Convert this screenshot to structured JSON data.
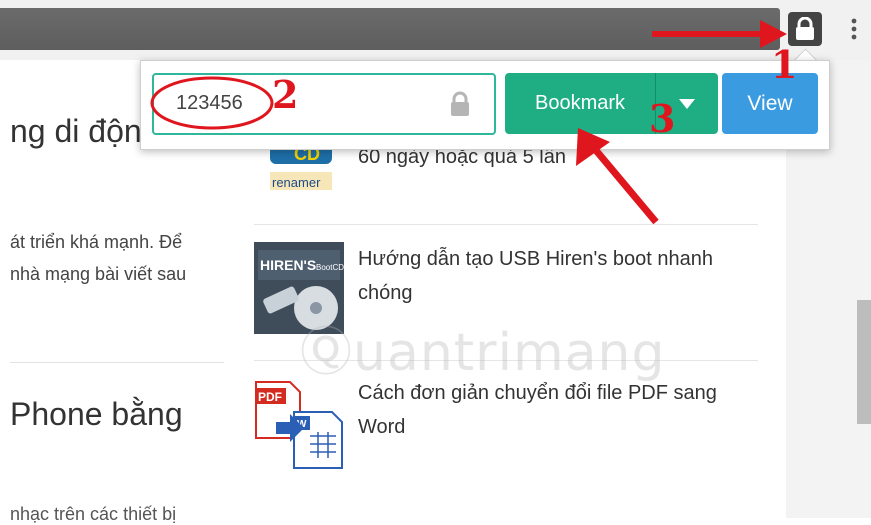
{
  "popup": {
    "password_value": "123456",
    "bookmark_label": "Bookmark",
    "view_label": "View"
  },
  "left_column": {
    "heading1": "ng di động",
    "para1_line1": "át triển khá mạnh. Để",
    "para1_line2": "nhà mạng bài viết sau",
    "heading2": "Phone bằng",
    "para2_line1": "nhạc trên các thiết bị"
  },
  "articles": [
    {
      "title": "60 ngày hoặc quá 5 lần",
      "thumb_text": "CD renamer",
      "thumb_icon": "cd-renamer-icon"
    },
    {
      "title": "Hướng dẫn tạo USB Hiren's boot nhanh chóng",
      "thumb_text": "HIREN'S BootCD",
      "thumb_icon": "hirens-bootcd-icon"
    },
    {
      "title": "Cách đơn giản chuyển đổi file PDF sang Word",
      "thumb_text": "PDF",
      "thumb_icon": "pdf-to-word-icon"
    }
  ],
  "watermark": "uantrimang",
  "annotations": {
    "step1": "1",
    "step2": "2",
    "step3": "3",
    "color": "#e0161e"
  },
  "colors": {
    "bookmark_button": "#1fae84",
    "view_button": "#3a9be0",
    "field_border": "#2eb79b"
  }
}
